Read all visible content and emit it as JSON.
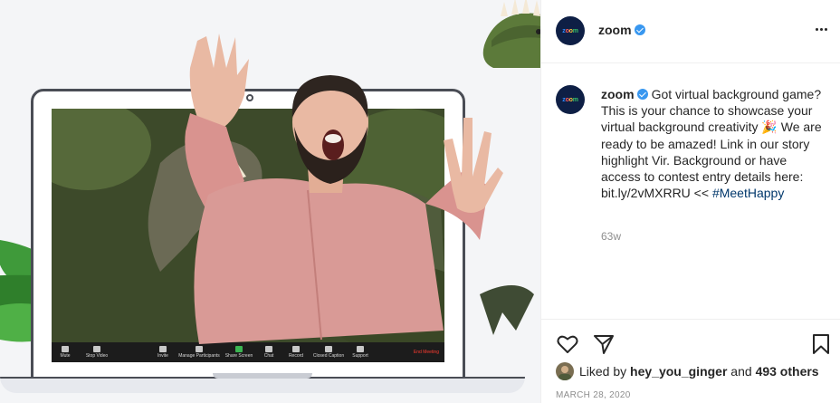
{
  "post": {
    "account": "zoom",
    "avatar_text": {
      "p1": "z",
      "p2": "o",
      "p3": "o",
      "p4": "m"
    },
    "caption_user": "zoom",
    "caption_text": "Got virtual background game? This is your chance to showcase your virtual background creativity 🎉 We are ready to be amazed! Link in our story highlight Vir. Background or have access to contest entry details here: ",
    "caption_link": "bit.ly/2vMXRRU",
    "caption_sep": " << ",
    "caption_hashtag": "#MeetHappy",
    "time_ago": "63w",
    "liked_by_prefix": "Liked by ",
    "liked_by_user": "hey_you_ginger",
    "liked_by_and": " and ",
    "liked_by_others": "493 others",
    "date": "MARCH 28, 2020"
  },
  "zoom_toolbar": {
    "mute": "Mute",
    "stop_video": "Stop Video",
    "invite": "Invite",
    "participants": "Manage Participants",
    "share": "Share Screen",
    "chat": "Chat",
    "record": "Record",
    "captions": "Closed Caption",
    "support": "Support",
    "end": "End Meeting"
  },
  "icons": {
    "more": "more-options-icon",
    "like": "heart-icon",
    "share": "paper-plane-icon",
    "save": "bookmark-icon",
    "verified": "verified-badge-icon"
  },
  "colors": {
    "verified": "#3897f0",
    "hashtag": "#00376b",
    "muted": "#8e8e8e",
    "zoom_blue": "#2d8cff"
  }
}
